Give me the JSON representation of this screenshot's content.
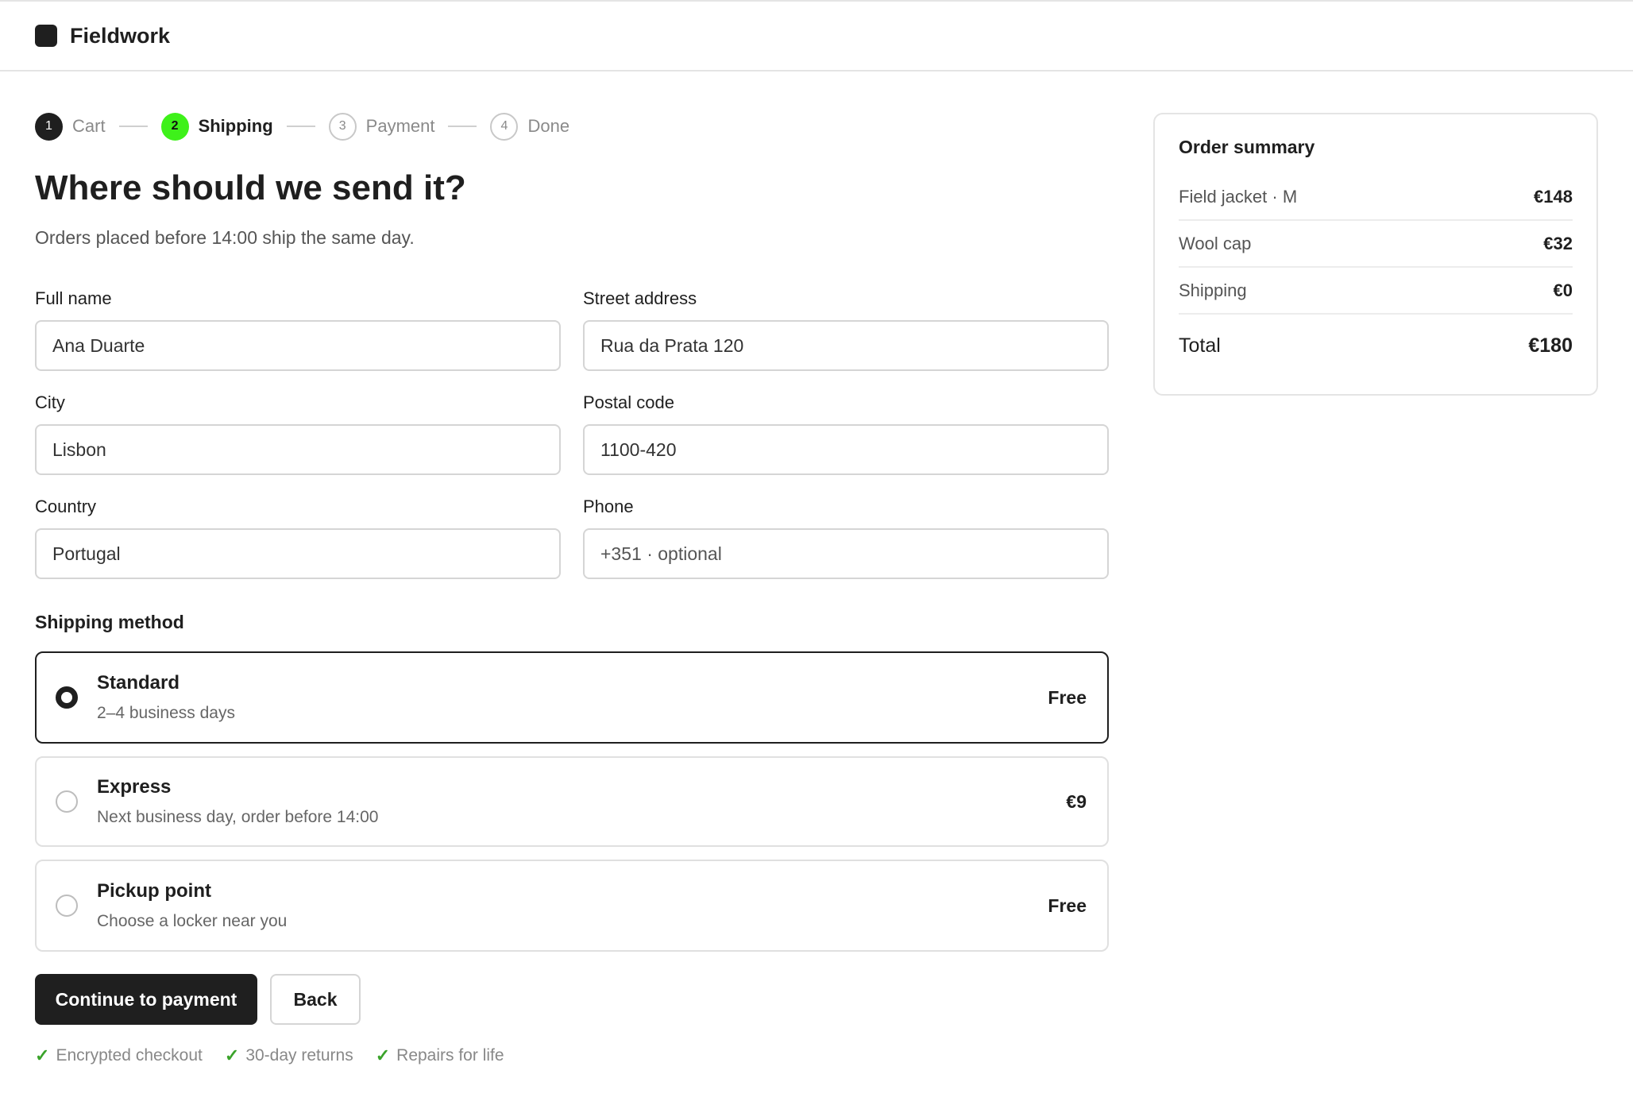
{
  "app": {
    "brand": "Fieldwork"
  },
  "steps": [
    {
      "number": "1",
      "label": "Cart",
      "state": "done"
    },
    {
      "number": "2",
      "label": "Shipping",
      "state": "active"
    },
    {
      "number": "3",
      "label": "Payment",
      "state": "todo"
    },
    {
      "number": "4",
      "label": "Done",
      "state": "todo"
    }
  ],
  "page": {
    "title": "Where should we send it?",
    "subtitle": "Orders placed before 14:00 ship the same day."
  },
  "form": {
    "full_name": {
      "label": "Full name",
      "value": "Ana Duarte"
    },
    "street": {
      "label": "Street address",
      "value": "Rua da Prata 120"
    },
    "city": {
      "label": "City",
      "value": "Lisbon"
    },
    "postal": {
      "label": "Postal code",
      "value": "1100-420"
    },
    "country": {
      "label": "Country",
      "value": "Portugal"
    },
    "phone": {
      "label": "Phone",
      "placeholder": "+351 · optional"
    }
  },
  "shipping": {
    "title": "Shipping method",
    "options": [
      {
        "title": "Standard",
        "subtitle": "2–4 business days",
        "price": "Free",
        "selected": true
      },
      {
        "title": "Express",
        "subtitle": "Next business day, order before 14:00",
        "price": "€9",
        "selected": false
      },
      {
        "title": "Pickup point",
        "subtitle": "Choose a locker near you",
        "price": "Free",
        "selected": false
      }
    ]
  },
  "actions": {
    "continue_label": "Continue to payment",
    "back_label": "Back"
  },
  "trust": [
    "Encrypted checkout",
    "30-day returns",
    "Repairs for life"
  ],
  "summary": {
    "title": "Order summary",
    "items": [
      {
        "label": "Field jacket · M",
        "amount": "€148"
      },
      {
        "label": "Wool cap",
        "amount": "€32"
      },
      {
        "label": "Shipping",
        "amount": "€0"
      }
    ],
    "total_label": "Total",
    "total_amount": "€180"
  },
  "colors": {
    "accent": "#3ef11a",
    "primary": "#1f1f1f",
    "check": "#3aa32a"
  }
}
